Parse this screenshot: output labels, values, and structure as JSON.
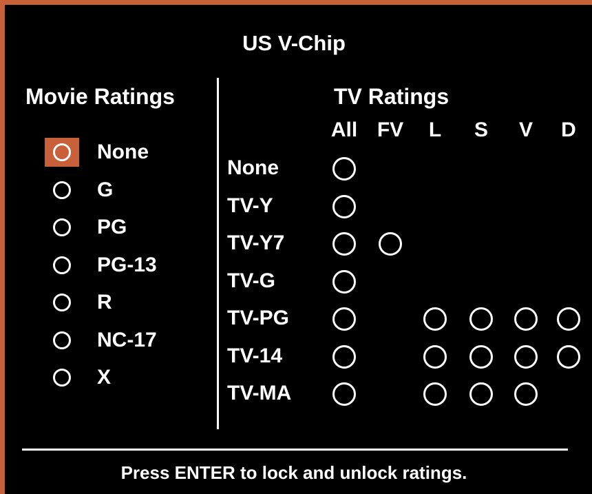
{
  "title": "US V-Chip",
  "movie": {
    "heading": "Movie Ratings",
    "items": [
      {
        "label": "None",
        "selected": true
      },
      {
        "label": "G",
        "selected": false
      },
      {
        "label": "PG",
        "selected": false
      },
      {
        "label": "PG-13",
        "selected": false
      },
      {
        "label": "R",
        "selected": false
      },
      {
        "label": "NC-17",
        "selected": false
      },
      {
        "label": "X",
        "selected": false
      }
    ]
  },
  "tv": {
    "heading": "TV Ratings",
    "columns": [
      "All",
      "FV",
      "L",
      "S",
      "V",
      "D"
    ],
    "rows": [
      {
        "label": "None",
        "options": [
          true,
          false,
          false,
          false,
          false,
          false
        ]
      },
      {
        "label": "TV-Y",
        "options": [
          true,
          false,
          false,
          false,
          false,
          false
        ]
      },
      {
        "label": "TV-Y7",
        "options": [
          true,
          true,
          false,
          false,
          false,
          false
        ]
      },
      {
        "label": "TV-G",
        "options": [
          true,
          false,
          false,
          false,
          false,
          false
        ]
      },
      {
        "label": "TV-PG",
        "options": [
          true,
          false,
          true,
          true,
          true,
          true
        ]
      },
      {
        "label": "TV-14",
        "options": [
          true,
          false,
          true,
          true,
          true,
          true
        ]
      },
      {
        "label": "TV-MA",
        "options": [
          true,
          false,
          true,
          true,
          true,
          false
        ]
      }
    ]
  },
  "footer": "Press ENTER to lock and unlock ratings.",
  "colors": {
    "accent": "#c8603a",
    "background": "#000000",
    "text": "#ffffff"
  }
}
